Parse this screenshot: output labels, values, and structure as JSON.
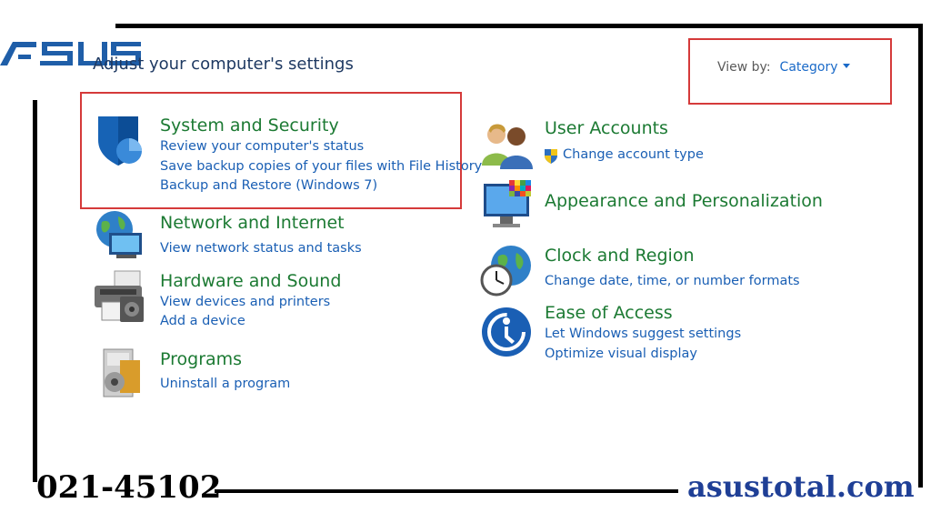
{
  "watermark": {
    "brand": "ASUS",
    "phone": "021-45102",
    "website": "asustotal.com"
  },
  "header": {
    "title": "Adjust your computer's settings",
    "view_by_label": "View by:",
    "view_by_value": "Category"
  },
  "categories": {
    "system": {
      "title": "System and Security",
      "links": [
        "Review your computer's status",
        "Save backup copies of your files with File History",
        "Backup and Restore (Windows 7)"
      ]
    },
    "network": {
      "title": "Network and Internet",
      "links": [
        "View network status and tasks"
      ]
    },
    "hardware": {
      "title": "Hardware and Sound",
      "links": [
        "View devices and printers",
        "Add a device"
      ]
    },
    "programs": {
      "title": "Programs",
      "links": [
        "Uninstall a program"
      ]
    },
    "users": {
      "title": "User Accounts",
      "links": [
        "Change account type"
      ]
    },
    "appearance": {
      "title": "Appearance and Personalization",
      "links": []
    },
    "clock": {
      "title": "Clock and Region",
      "links": [
        "Change date, time, or number formats"
      ]
    },
    "ease": {
      "title": "Ease of Access",
      "links": [
        "Let Windows suggest settings",
        "Optimize visual display"
      ]
    }
  },
  "colors": {
    "title_green": "#1c7a33",
    "link_blue": "#1a5fb4",
    "highlight_red": "#d53a3a",
    "brand_blue": "#1f3f96"
  }
}
